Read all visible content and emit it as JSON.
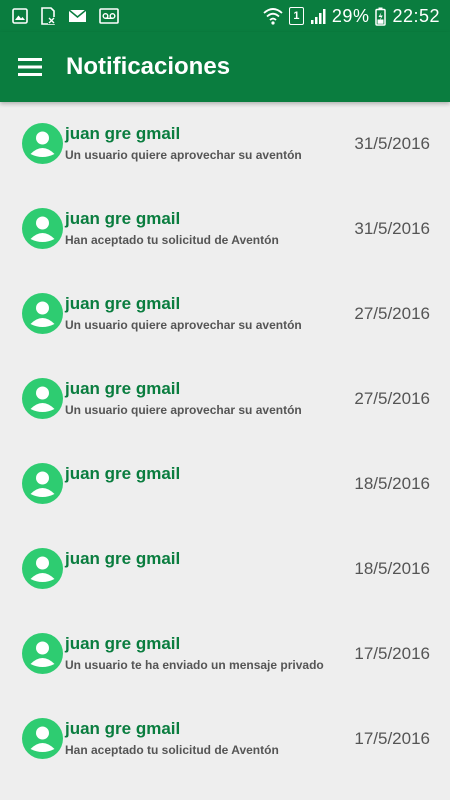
{
  "status_bar": {
    "battery": "29%",
    "time": "22:52",
    "sim_slot": "1",
    "left_icons": [
      "image-icon",
      "sd-card-icon",
      "mail-icon",
      "voicemail-icon"
    ],
    "right_icons": [
      "wifi-icon",
      "sim-icon",
      "signal-icon",
      "battery-icon"
    ]
  },
  "app_bar": {
    "menu_icon": "hamburger-menu-icon",
    "title": "Notificaciones"
  },
  "colors": {
    "primary": "#0a7d3f",
    "avatar": "#2ecc71",
    "background": "#eeeeee",
    "secondary_text": "#555555"
  },
  "notifications": [
    {
      "title": "juan gre gmail",
      "subtitle": "Un usuario quiere aprovechar su aventón",
      "date": "31/5/2016"
    },
    {
      "title": "juan gre gmail",
      "subtitle": "Han aceptado tu solicitud de Aventón",
      "date": "31/5/2016"
    },
    {
      "title": "juan gre gmail",
      "subtitle": "Un usuario quiere aprovechar su aventón",
      "date": "27/5/2016"
    },
    {
      "title": "juan gre gmail",
      "subtitle": "Un usuario quiere aprovechar su aventón",
      "date": "27/5/2016"
    },
    {
      "title": "juan gre gmail",
      "subtitle": "",
      "date": "18/5/2016"
    },
    {
      "title": "juan gre gmail",
      "subtitle": "",
      "date": "18/5/2016"
    },
    {
      "title": "juan gre gmail",
      "subtitle": "Un usuario te ha enviado un mensaje privado",
      "date": "17/5/2016"
    },
    {
      "title": "juan gre gmail",
      "subtitle": "Han aceptado tu solicitud de Aventón",
      "date": "17/5/2016"
    }
  ]
}
